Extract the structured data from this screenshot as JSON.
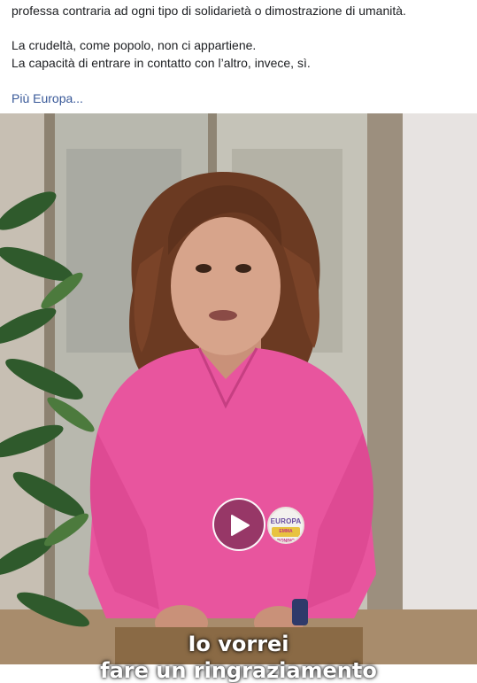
{
  "post": {
    "line1": "professa contraria ad ogni tipo di solidarietà o dimostrazione di umanità.",
    "line2": "La crudeltà, come popolo, non ci appartiene.",
    "line3": "La capacità di entrare in contatto con l’altro, invece, sì.",
    "more_link": "Più Europa..."
  },
  "video": {
    "badge_top": "EUROPA",
    "badge_bottom": "EMMA BONINO",
    "caption_line1": "Io vorrei",
    "caption_line2": "fare un ringraziamento"
  },
  "colors": {
    "link": "#385898",
    "text": "#1c1e21",
    "shirt": "#e8559e"
  }
}
